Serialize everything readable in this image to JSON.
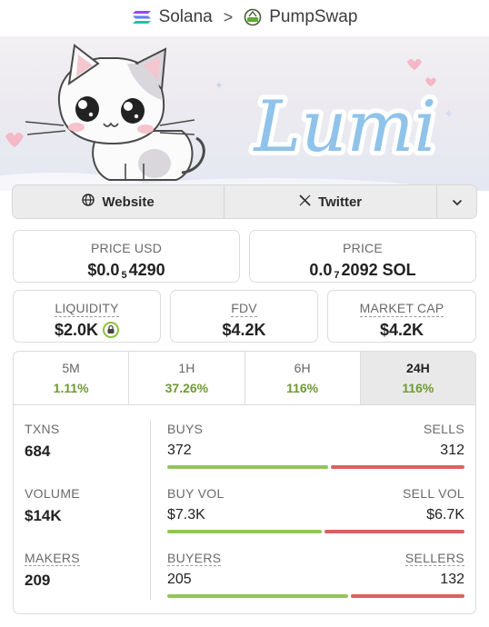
{
  "breadcrumb": {
    "chain": "Solana",
    "separator": ">",
    "dex": "PumpSwap"
  },
  "banner": {
    "title": "Lumi"
  },
  "links": {
    "website": "Website",
    "twitter": "Twitter"
  },
  "price": {
    "usd_label": "PRICE USD",
    "usd_prefix": "$0.0",
    "usd_zeros": "5",
    "usd_digits": "4290",
    "sol_label": "PRICE",
    "sol_prefix": "0.0",
    "sol_zeros": "7",
    "sol_digits": "2092 SOL"
  },
  "stats": {
    "liquidity_label": "LIQUIDITY",
    "liquidity_value": "$2.0K",
    "fdv_label": "FDV",
    "fdv_value": "$4.2K",
    "mcap_label": "MARKET CAP",
    "mcap_value": "$4.2K"
  },
  "tabs": [
    {
      "label": "5M",
      "change": "1.11%"
    },
    {
      "label": "1H",
      "change": "37.26%"
    },
    {
      "label": "6H",
      "change": "116%"
    },
    {
      "label": "24H",
      "change": "116%"
    }
  ],
  "active_tab": "24H",
  "metrics": {
    "txns_label": "TXNS",
    "txns_value": "684",
    "buys_label": "BUYS",
    "buys_value": "372",
    "sells_label": "SELLS",
    "sells_value": "312",
    "volume_label": "VOLUME",
    "volume_value": "$14K",
    "buyvol_label": "BUY VOL",
    "buyvol_value": "$7.3K",
    "sellvol_label": "SELL VOL",
    "sellvol_value": "$6.7K",
    "makers_label": "MAKERS",
    "makers_value": "209",
    "buyers_label": "BUYERS",
    "buyers_value": "205",
    "sellers_label": "SELLERS",
    "sellers_value": "132"
  },
  "colors": {
    "positive": "#6f9a33",
    "buy_bar": "#93c55a",
    "sell_bar": "#d9625e",
    "lumi_blue": "#8fc3ea"
  }
}
